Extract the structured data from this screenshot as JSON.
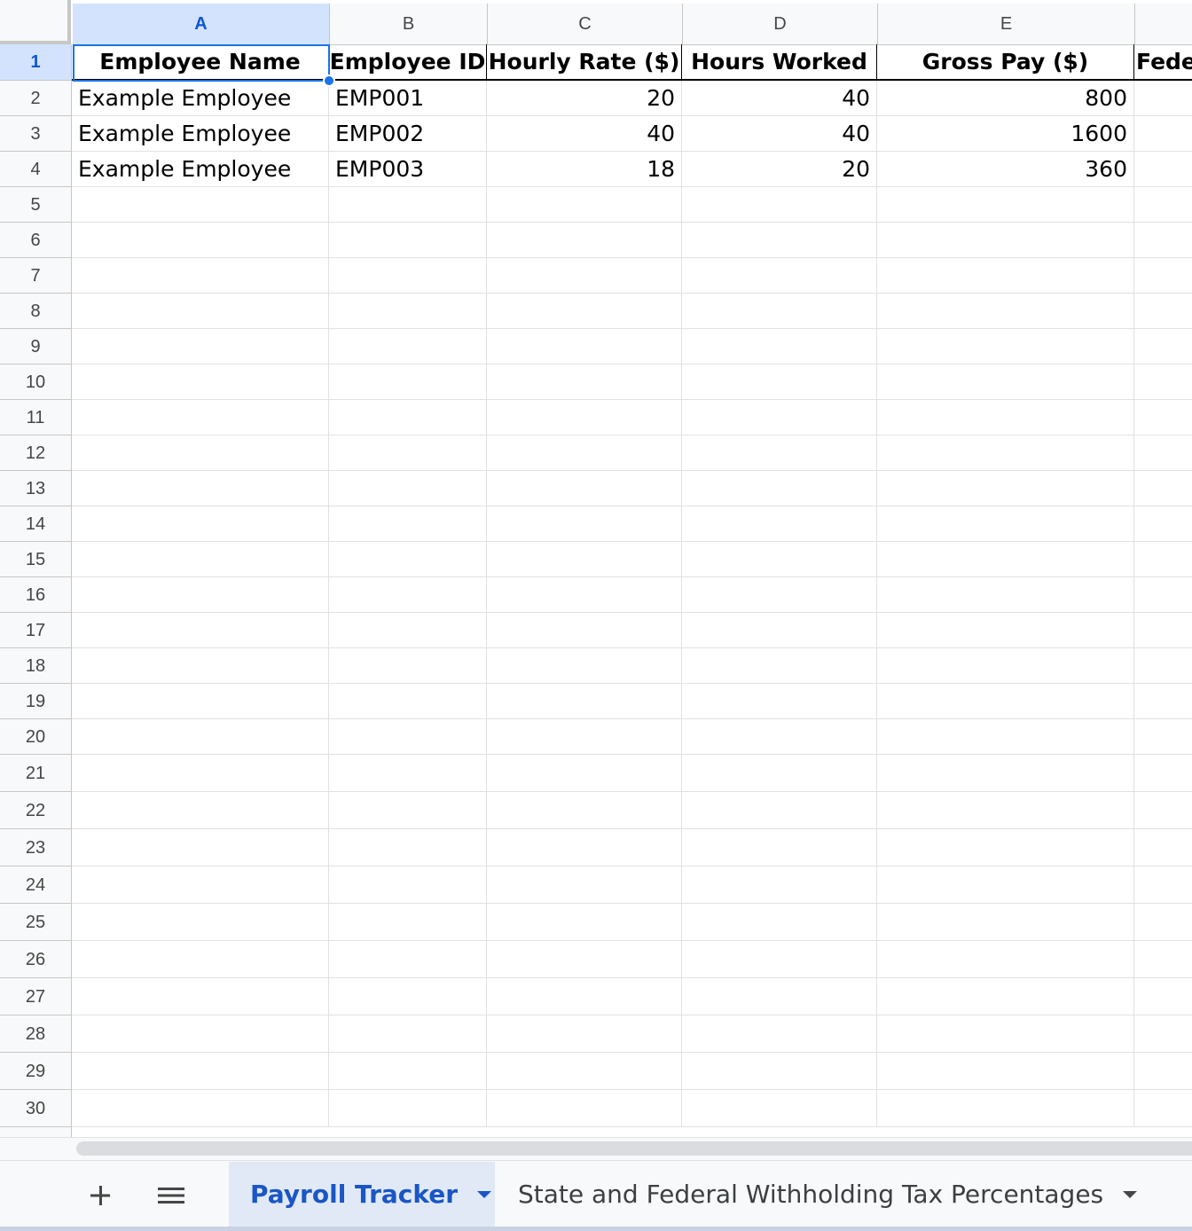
{
  "columns": [
    "A",
    "B",
    "C",
    "D",
    "E"
  ],
  "selected_column": "A",
  "selected_row": "1",
  "rows": [
    "1",
    "2",
    "3",
    "4",
    "5",
    "6",
    "7",
    "8",
    "9",
    "10",
    "11",
    "12",
    "13",
    "14",
    "15",
    "16",
    "17",
    "18",
    "19",
    "20",
    "21",
    "22",
    "23",
    "24",
    "25",
    "26",
    "27",
    "28",
    "29",
    "30"
  ],
  "table": {
    "headers": [
      "Employee Name",
      "Employee ID",
      "Hourly Rate ($)",
      "Hours Worked",
      "Gross Pay ($)",
      "Feder"
    ],
    "data": [
      [
        "Example Employee",
        "EMP001",
        "20",
        "40",
        "800"
      ],
      [
        "Example Employee",
        "EMP002",
        "40",
        "40",
        "1600"
      ],
      [
        "Example Employee",
        "EMP003",
        "18",
        "20",
        "360"
      ]
    ]
  },
  "tab_bar": {
    "add_icon": "plus-icon",
    "menu_icon": "hamburger-menu-icon",
    "tabs": [
      {
        "label": "Payroll Tracker",
        "active": true
      },
      {
        "label": "State and Federal Withholding Tax Percentages",
        "active": false
      }
    ]
  },
  "colors": {
    "selection_blue": "#1a73e8",
    "header_selected_bg": "#d3e3fd",
    "active_tab_text": "#1a56c4",
    "grid_line": "#e1e1e1"
  }
}
